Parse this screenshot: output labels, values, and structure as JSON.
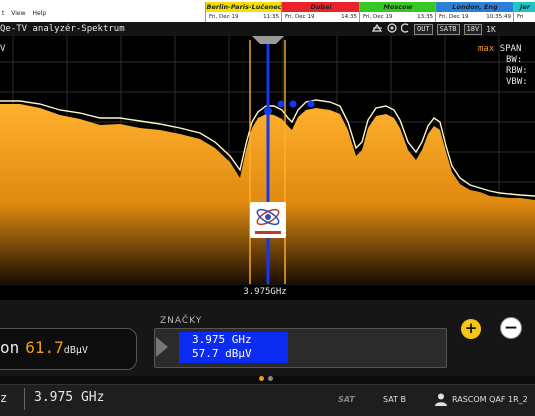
{
  "menu": [
    "t",
    "View",
    "Help"
  ],
  "clocks": [
    {
      "city": "Berlin-Paris-Lučenec",
      "date": "Fri, Dec 19",
      "time": "11:35",
      "color": "#f6e000"
    },
    {
      "city": "Dubai",
      "date": "Fri, Dec 19",
      "time": "14:35",
      "color": "#e8232a"
    },
    {
      "city": "Moscow",
      "date": "Fri, Dec 19",
      "time": "13:35",
      "color": "#35c820"
    },
    {
      "city": "London, Eng",
      "date": "Fri, Dec 19",
      "time": "10:35:49",
      "color": "#2a7fd8"
    },
    {
      "city": "Jer",
      "date": "Fri",
      "time": "",
      "color": "#1ec6c6"
    }
  ],
  "title": {
    "text": "Qe-TV analyzér-Spektrum",
    "out": "OUT",
    "satb": "SATB",
    "volt": "18V",
    "right_text": "1K"
  },
  "spectrum": {
    "left_label": "V",
    "max": "max",
    "span": "SPAN",
    "bw": "BW:",
    "rbw": "RBW:",
    "vbw": "VBW:",
    "marker_freq_label": "3.975GHz"
  },
  "level": {
    "prefix": "on",
    "value": "61.7",
    "unit": "dBµV"
  },
  "markers": {
    "title": "ZNAČKY",
    "freq": "3.975 GHz",
    "level": "57.7 dBµV"
  },
  "buttons": {
    "plus": "+",
    "minus": "−"
  },
  "status": {
    "left": "z",
    "freq": "3.975 GHz",
    "sat_logo": "SAT",
    "sat_name": "SAT B",
    "user": "RASCOM QAF 1R_2"
  },
  "colors": {
    "accent": "#f39c12",
    "marker_blue": "#0c2bf0",
    "spectrum_fill": "#f5a623",
    "envelope": "#fff6c8"
  }
}
